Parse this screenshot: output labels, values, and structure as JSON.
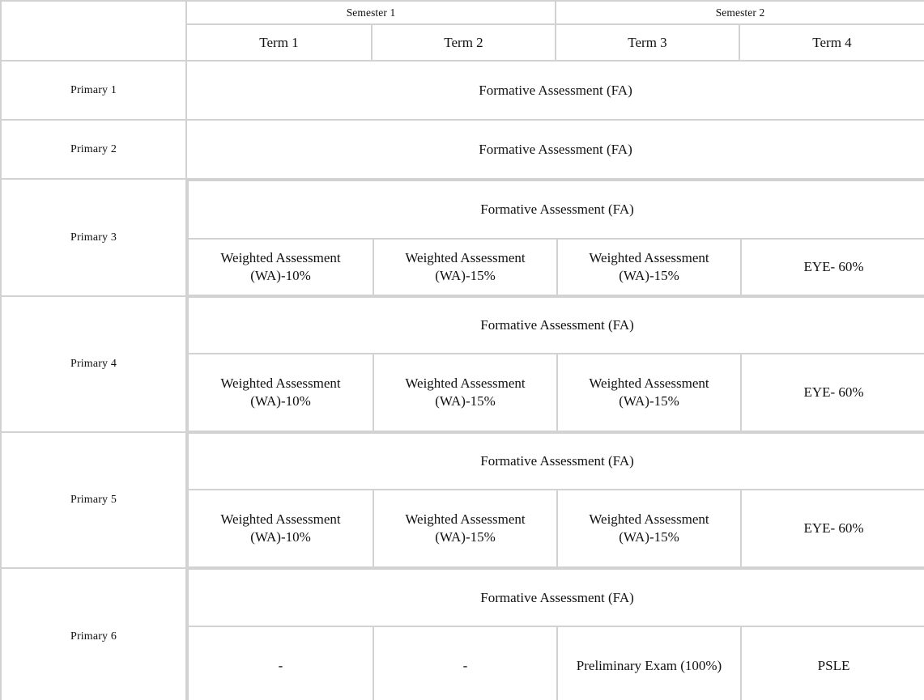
{
  "table": {
    "header": {
      "corner_label": "",
      "semesters": [
        {
          "label": "Semester 1",
          "span": 2
        },
        {
          "label": "Semester 2",
          "span": 2
        }
      ],
      "terms": [
        "Term 1",
        "Term 2",
        "Term 3",
        "Term 4"
      ]
    },
    "labels": {
      "formative_assessment": "Formative Assessment (FA)",
      "wa_10": "Weighted Assessment (WA)-10%",
      "wa_15": "Weighted Assessment (WA)-15%",
      "eye_60": "EYE- 60%",
      "dash": "-",
      "prelim": "Preliminary Exam (100%)",
      "psle": "PSLE"
    },
    "rows": [
      {
        "level": "Primary 1",
        "type": "single",
        "band": "Formative Assessment (FA)"
      },
      {
        "level": "Primary 2",
        "type": "single",
        "band": "Formative Assessment (FA)"
      },
      {
        "level": "Primary 3",
        "type": "split",
        "band": "Formative Assessment (FA)",
        "cells": [
          "Weighted Assessment (WA)-10%",
          "Weighted Assessment (WA)-15%",
          "Weighted Assessment (WA)-15%",
          "EYE- 60%"
        ]
      },
      {
        "level": "Primary 4",
        "type": "split",
        "band": "Formative Assessment (FA)",
        "cells": [
          "Weighted Assessment (WA)-10%",
          "Weighted Assessment (WA)-15%",
          "Weighted Assessment (WA)-15%",
          "EYE- 60%"
        ]
      },
      {
        "level": "Primary 5",
        "type": "split",
        "band": "Formative Assessment (FA)",
        "cells": [
          "Weighted Assessment (WA)-10%",
          "Weighted Assessment (WA)-15%",
          "Weighted Assessment (WA)-15%",
          "EYE- 60%"
        ]
      },
      {
        "level": "Primary 6",
        "type": "split",
        "band": "Formative Assessment (FA)",
        "cells": [
          "-",
          "-",
          "Preliminary Exam (100%)",
          "PSLE"
        ]
      }
    ],
    "style": {
      "border_color": "#d2d2d2",
      "text_color": "#111111",
      "background": "#ffffff"
    }
  }
}
